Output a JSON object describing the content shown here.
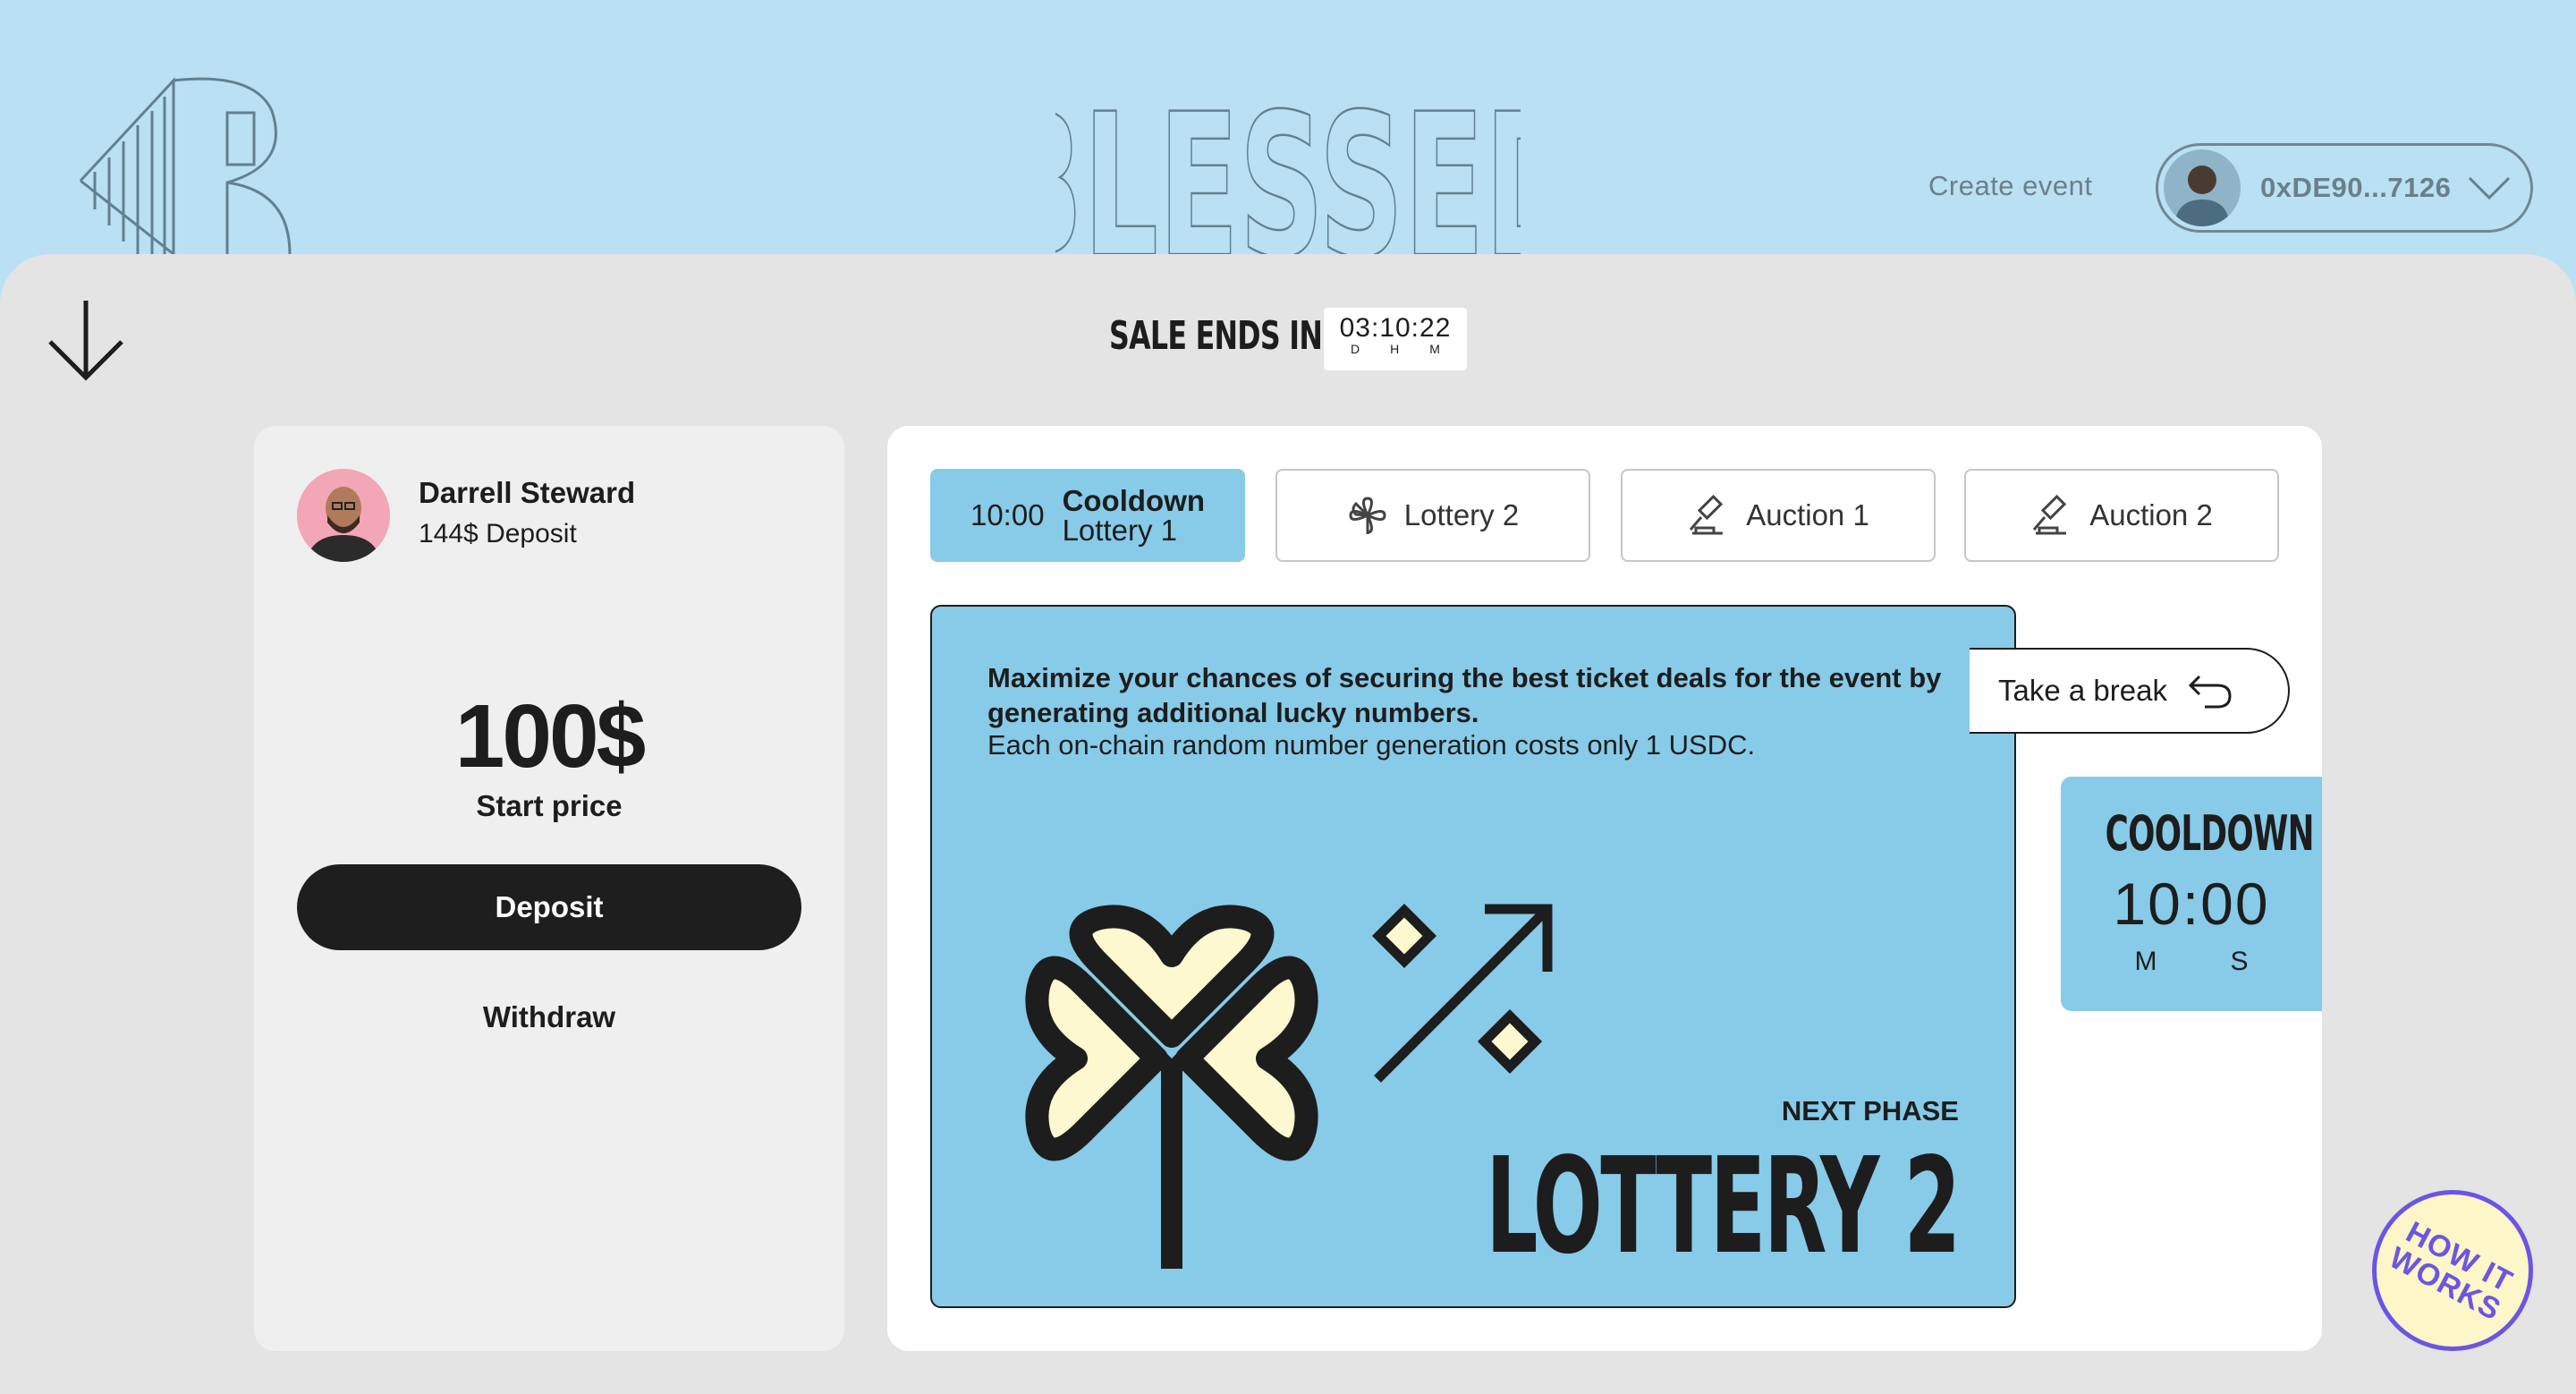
{
  "header": {
    "brand": "BLESSED",
    "create_event": "Create event",
    "wallet_address": "0xDE90...7126"
  },
  "sale": {
    "label": "SALE ENDS IN",
    "timer": "03:10:22",
    "units": [
      "D",
      "H",
      "M"
    ]
  },
  "user": {
    "name": "Darrell Steward",
    "deposit": "144$ Deposit",
    "price": "100$",
    "price_label": "Start price",
    "deposit_button": "Deposit",
    "withdraw": "Withdraw"
  },
  "tabs": [
    {
      "time": "10:00",
      "title": "Cooldown",
      "subtitle": "Lottery 1",
      "active": true
    },
    {
      "label": "Lottery 2",
      "icon": "clover-icon"
    },
    {
      "label": "Auction 1",
      "icon": "gavel-icon"
    },
    {
      "label": "Auction 2",
      "icon": "gavel-icon"
    }
  ],
  "panel": {
    "title": "Maximize your chances of securing the best ticket deals for the event by generating additional lucky numbers.",
    "description": "Each on-chain random number generation costs only 1 USDC.",
    "next_label": "NEXT PHASE",
    "next_phase": "LOTTERY 2"
  },
  "break_button": "Take a break",
  "cooldown": {
    "label": "COOLDOWN",
    "time": "10:00",
    "units": [
      "M",
      "S"
    ]
  },
  "help": {
    "line1": "HOW IT",
    "line2": "WORKS"
  },
  "colors": {
    "header_bg": "#b9e1f3",
    "sheet_bg": "#e4e4e4",
    "accent_blue": "#87cbe8",
    "clover_fill": "#fdf8cf",
    "help_purple": "#6b55e6"
  }
}
